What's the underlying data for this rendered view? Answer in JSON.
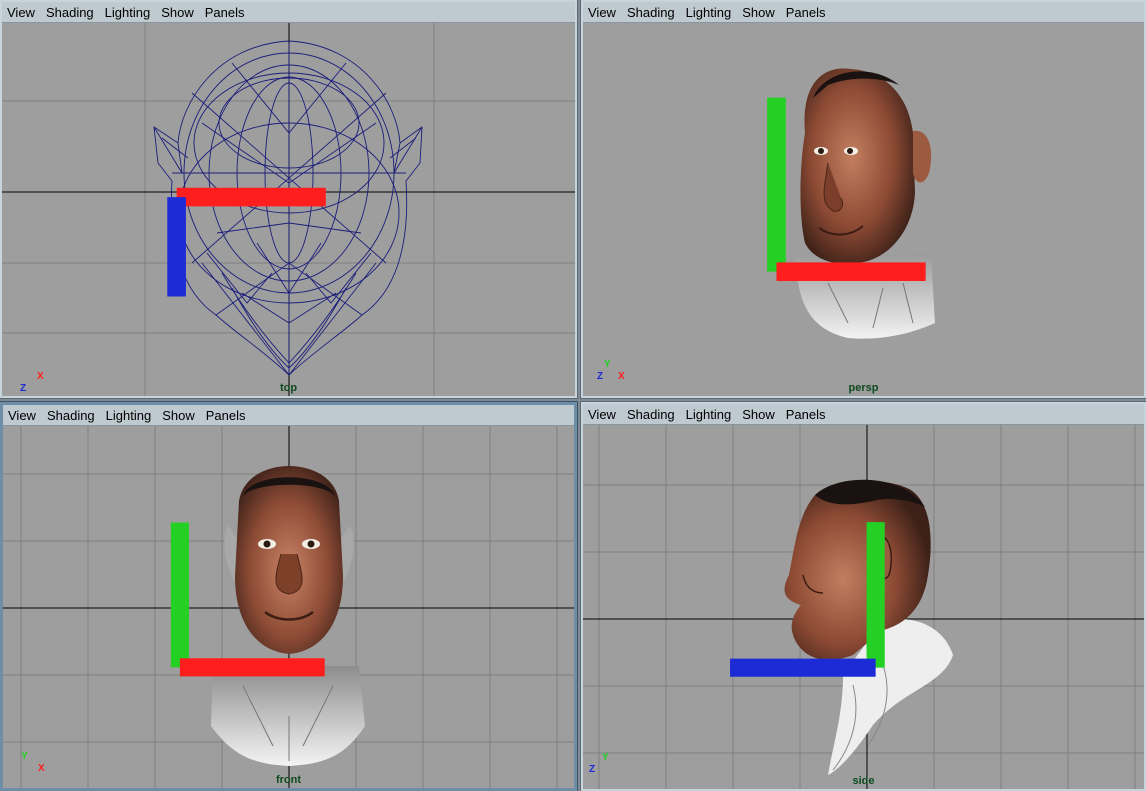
{
  "menu": [
    "View",
    "Shading",
    "Lighting",
    "Show",
    "Panels"
  ],
  "panes": {
    "top": {
      "camera": "top",
      "axes": {
        "h": "X",
        "v": "Z"
      }
    },
    "persp": {
      "camera": "persp",
      "axes": {
        "v": "Y",
        "h1": "Z",
        "h2": "X"
      }
    },
    "front": {
      "camera": "front",
      "axes": {
        "v": "Y",
        "h": "X"
      }
    },
    "side": {
      "camera": "side",
      "axes": {
        "v": "Y",
        "h": "Z"
      }
    }
  },
  "colors": {
    "viewport_bg": "#9e9e9e",
    "grid": "#7f7f7f",
    "wireframe": "#1b1e7a",
    "axis_x": "#ff1e1e",
    "axis_y": "#23d023",
    "axis_z": "#1d2bd6",
    "camera_label": "#0d4a1d"
  }
}
